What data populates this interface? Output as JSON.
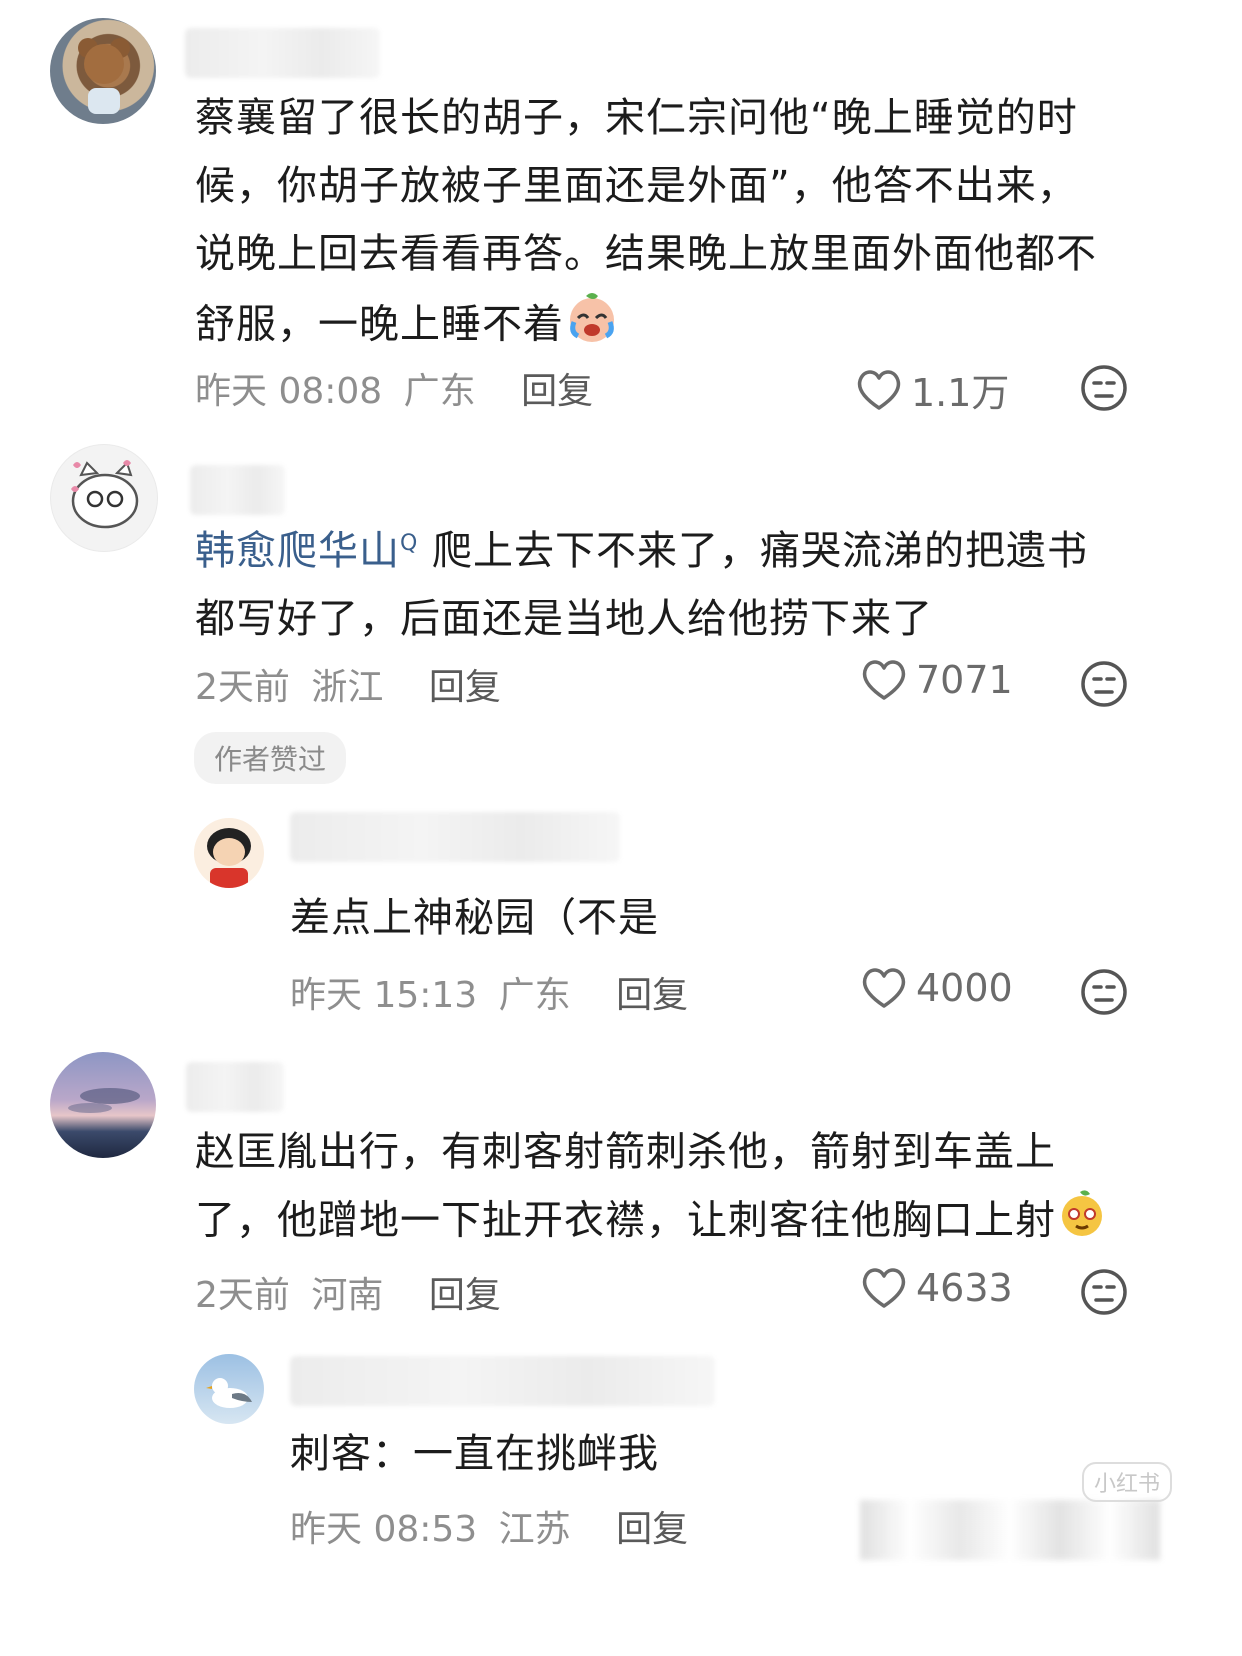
{
  "comments": [
    {
      "text_lines": [
        "蔡襄留了很长的胡子，宋仁宗问他“晚上睡觉的时",
        "候，你胡子放被子里面还是外面”，他答不出来，",
        "说晚上回去看看再答。结果晚上放里面外面他都不",
        "舒服，一晚上睡不着"
      ],
      "time": "昨天 08:08",
      "location": "广东",
      "reply": "回复",
      "likes": "1.1万"
    },
    {
      "tag": "韩愈爬华山",
      "tag_icon": "Q",
      "text_lines": [
        " 爬上去下不来了，痛哭流涕的把遗书",
        "都写好了，后面还是当地人给他捞下来了"
      ],
      "time": "2天前",
      "location": "浙江",
      "reply": "回复",
      "likes": "7071",
      "badge": "作者赞过"
    },
    {
      "text_lines": [
        "差点上神秘园（不是"
      ],
      "time": "昨天 15:13",
      "location": "广东",
      "reply": "回复",
      "likes": "4000"
    },
    {
      "text_lines": [
        "赵匡胤出行，有刺客射箭刺杀他，箭射到车盖上",
        "了，他蹭地一下扯开衣襟，让刺客往他胸口上射"
      ],
      "time": "2天前",
      "location": "河南",
      "reply": "回复",
      "likes": "4633"
    },
    {
      "text_lines": [
        "刺客：一直在挑衅我"
      ],
      "time": "昨天 08:53",
      "location": "江苏",
      "reply": "回复"
    }
  ],
  "watermark": "小红书",
  "icons": {
    "like": "heart-outline-icon",
    "dislike": "neutral-face-icon",
    "colors": {
      "text": "#1c1c1c",
      "meta": "#8e8e8e",
      "tag": "#3a5f8c"
    }
  }
}
